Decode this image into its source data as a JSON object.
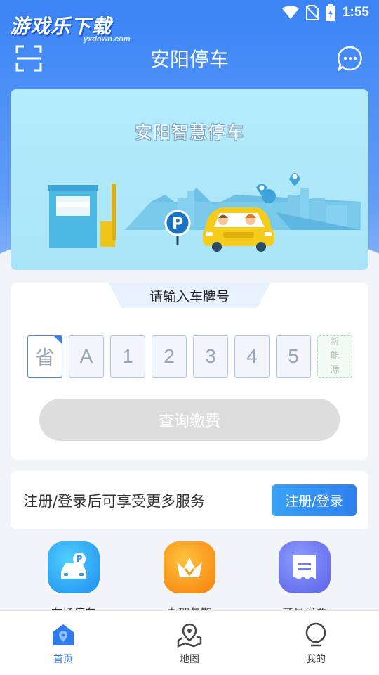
{
  "status_bar": {
    "time": "1:55"
  },
  "watermark": {
    "text": "游戏乐下载",
    "sub": "yxdown.com"
  },
  "header": {
    "title": "安阳停车"
  },
  "banner": {
    "title": "安阳智慧停车"
  },
  "plate_input": {
    "tab_label": "请输入车牌号",
    "cells": [
      "省",
      "A",
      "1",
      "2",
      "3",
      "4",
      "5"
    ],
    "new_energy": [
      "新",
      "能",
      "源"
    ],
    "query_button": "查询缴费"
  },
  "login_prompt": {
    "text": "注册/登录后可享受更多服务",
    "button": "注册/登录"
  },
  "features": [
    {
      "label": "在场停车",
      "icon": "parking-car-icon",
      "color": "#2f9cf3"
    },
    {
      "label": "办理包期",
      "icon": "crown-icon",
      "color": "#f79a1c"
    },
    {
      "label": "开具发票",
      "icon": "invoice-icon",
      "color": "#6f7df1"
    }
  ],
  "bottom_nav": [
    {
      "label": "首页",
      "icon": "home-icon",
      "active": true
    },
    {
      "label": "地图",
      "icon": "map-icon",
      "active": false
    },
    {
      "label": "我的",
      "icon": "profile-icon",
      "active": false
    }
  ],
  "colors": {
    "primary": "#2f7bec",
    "header_bg": "#3b84f5"
  }
}
